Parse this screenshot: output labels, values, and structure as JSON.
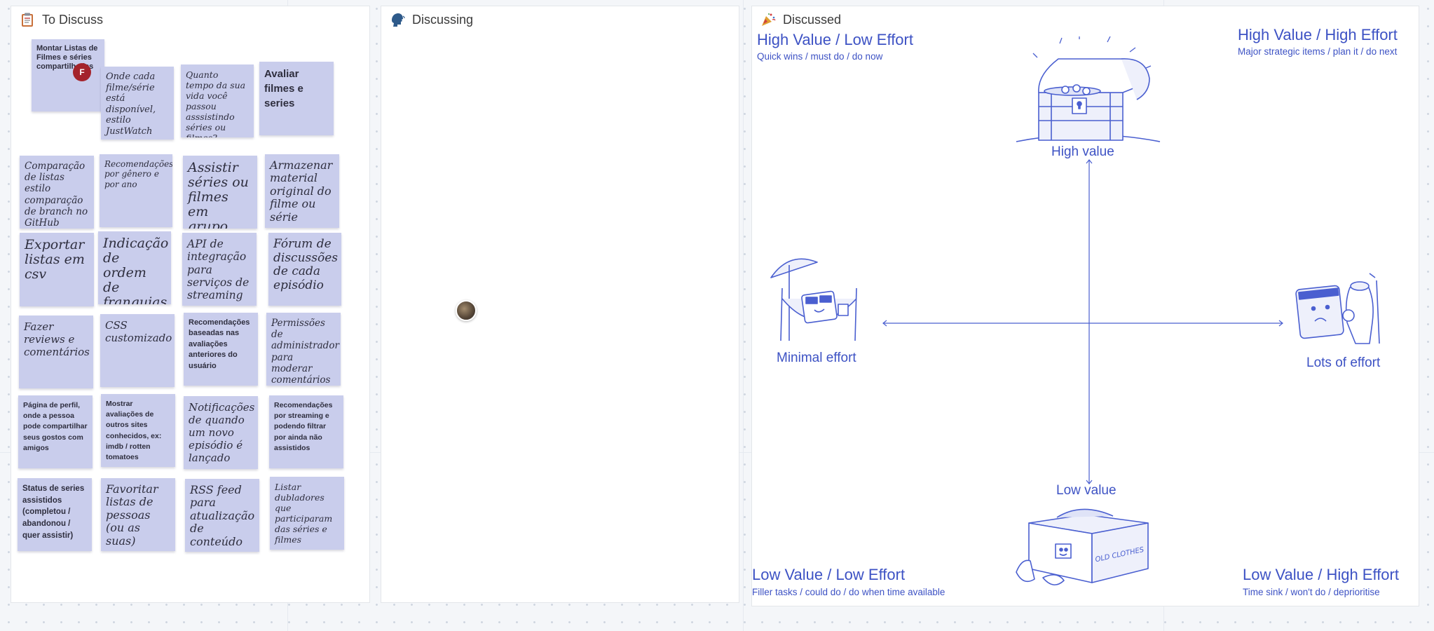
{
  "frames": {
    "to_discuss": {
      "title": "To Discuss",
      "icon": "clipboard-icon"
    },
    "discussing": {
      "title": "Discussing",
      "icon": "speaking-head-icon"
    },
    "discussed": {
      "title": "Discussed",
      "icon": "party-popper-icon"
    }
  },
  "stickies": [
    {
      "text": "Montar Listas de Filmes e séries compartilhadas"
    },
    {
      "text": "Onde cada filme/série está disponível, estilo JustWatch"
    },
    {
      "text": "Quanto tempo da sua vida você passou asssistindo séries ou filmes?"
    },
    {
      "text": "Avaliar filmes e series"
    },
    {
      "text": "Comparação de listas estilo comparação de branch no GitHub"
    },
    {
      "text": "Recomendações por gênero e por ano"
    },
    {
      "text": "Assistir séries ou filmes em grupo"
    },
    {
      "text": "Armazenar material original do filme ou série"
    },
    {
      "text": "Exportar listas em csv"
    },
    {
      "text": "Indicação de ordem de franquias"
    },
    {
      "text": "API de integração para serviços de streaming"
    },
    {
      "text": "Fórum de discussões de cada episódio"
    },
    {
      "text": "Fazer reviews e comentários"
    },
    {
      "text": "CSS customizado"
    },
    {
      "text": "Recomendações baseadas nas avaliações anteriores do usuário"
    },
    {
      "text": "Permissões de administrador para moderar comentários"
    },
    {
      "text": "Página de perfil, onde a pessoa pode compartilhar seus gostos com amigos"
    },
    {
      "text": "Mostrar avaliações de outros sites conhecidos, ex: imdb / rotten tomatoes"
    },
    {
      "text": "Notificações de quando um novo episódio é lançado"
    },
    {
      "text": "Recomendações por streaming e podendo filtrar por ainda não assistidos"
    },
    {
      "text": "Status de series assistidos (completou / abandonou / quer assistir)"
    },
    {
      "text": "Favoritar listas de pessoas (ou as suas)"
    },
    {
      "text": "RSS feed para atualização de conteúdo"
    },
    {
      "text": "Listar dubladores que participaram das séries e filmes"
    }
  ],
  "sticky_color": "#c9cdec",
  "collaborator_badge": "F",
  "matrix": {
    "color": "#3d52c4",
    "q1_title": "High Value / Low Effort",
    "q1_sub": "Quick wins / must do / do now",
    "q2_title": "High Value / High Effort",
    "q2_sub": "Major strategic items / plan it / do next",
    "q3_title": "Low Value / Low Effort",
    "q3_sub": "Filler tasks / could do / do when time available",
    "q4_title": "Low Value / High Effort",
    "q4_sub": "Time sink / won't do / deprioritise",
    "high_value": "High value",
    "low_value": "Low value",
    "minimal_effort": "Minimal effort",
    "lots_of_effort": "Lots of effort",
    "box_label": "OLD CLOTHES"
  }
}
